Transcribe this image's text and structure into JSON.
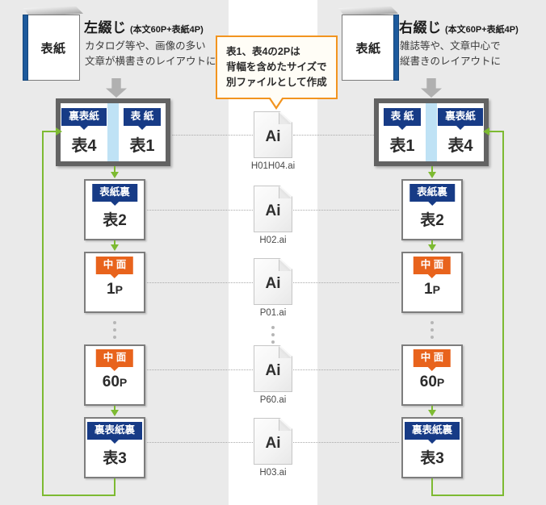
{
  "diagram": {
    "title_hidden": "",
    "left": {
      "book_label": "表紙",
      "binding_title": "左綴じ",
      "binding_spec": "(本文60P+表紙4P)",
      "desc_line1": "カタログ等や、画像の多い",
      "desc_line2": "文章が横書きのレイアウトに",
      "spread": {
        "left_tag": "裏表紙",
        "left_page": "表4",
        "right_tag": "表 紙",
        "right_page": "表1"
      },
      "pages": [
        {
          "tag": "表紙裏",
          "tag_color": "navy",
          "num": "表2",
          "unit": ""
        },
        {
          "tag": "中 面",
          "tag_color": "orange",
          "num": "1",
          "unit": "P"
        },
        {
          "tag": "中 面",
          "tag_color": "orange",
          "num": "60",
          "unit": "P"
        },
        {
          "tag": "裏表紙裏",
          "tag_color": "navy",
          "num": "表3",
          "unit": ""
        }
      ]
    },
    "right": {
      "book_label": "表紙",
      "binding_title": "右綴じ",
      "binding_spec": "(本文60P+表紙4P)",
      "desc_line1": "雑誌等や、文章中心で",
      "desc_line2": "縦書きのレイアウトに",
      "spread": {
        "left_tag": "表 紙",
        "left_page": "表1",
        "right_tag": "裏表紙",
        "right_page": "表4"
      },
      "pages": [
        {
          "tag": "表紙裏",
          "tag_color": "navy",
          "num": "表2",
          "unit": ""
        },
        {
          "tag": "中 面",
          "tag_color": "orange",
          "num": "1",
          "unit": "P"
        },
        {
          "tag": "中 面",
          "tag_color": "orange",
          "num": "60",
          "unit": "P"
        },
        {
          "tag": "裏表紙裏",
          "tag_color": "navy",
          "num": "表3",
          "unit": ""
        }
      ]
    },
    "callout": {
      "line1": "表1、表4の2Pは",
      "line2": "背幅を含めたサイズで",
      "line3": "別ファイルとして作成"
    },
    "files": [
      {
        "glyph": "Ai",
        "name": "H01H04.ai"
      },
      {
        "glyph": "Ai",
        "name": "H02.ai"
      },
      {
        "glyph": "Ai",
        "name": "P01.ai"
      },
      {
        "glyph": "Ai",
        "name": "P60.ai"
      },
      {
        "glyph": "Ai",
        "name": "H03.ai"
      }
    ],
    "colors": {
      "navy": "#173b86",
      "orange": "#e8631c",
      "green": "#7dba32",
      "callout_border": "#f2941f",
      "panel_bg": "#eaeaea",
      "spine_blue": "#1d5a9c",
      "gutter_blue": "#bfe2f5"
    }
  }
}
